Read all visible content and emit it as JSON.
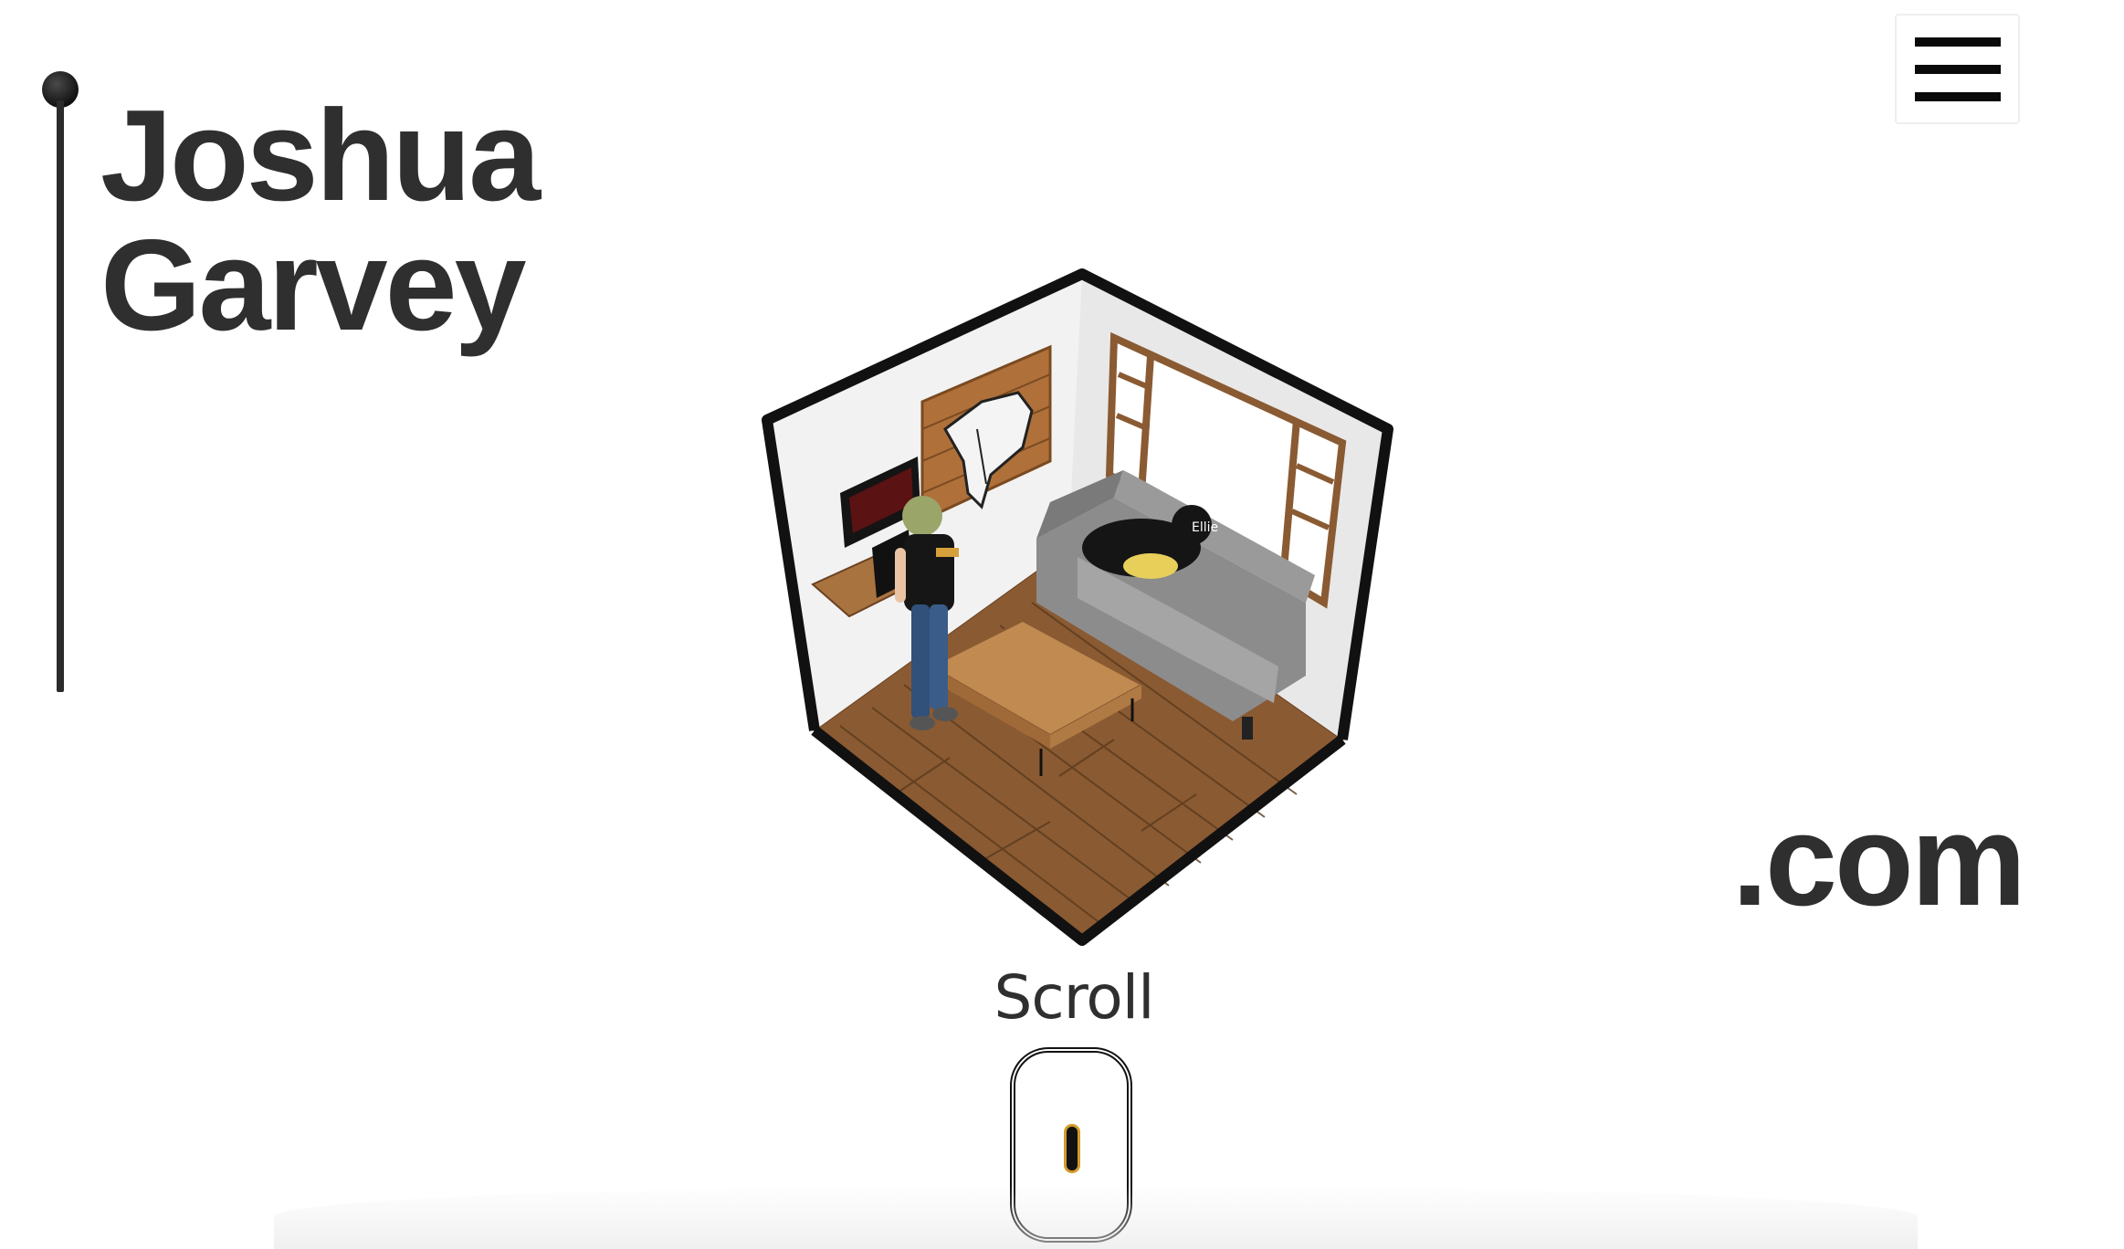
{
  "header": {
    "title_line1": "Joshua",
    "title_line2": "Garvey",
    "tld": ".com"
  },
  "menu": {
    "icon": "hamburger-icon"
  },
  "hero": {
    "illustration": "isometric-room-illustration",
    "dog_name": "Ellie"
  },
  "scroll_hint": {
    "label": "Scroll",
    "icon": "mouse-scroll-icon"
  },
  "colors": {
    "text": "#2f2f2f",
    "accent_wheel": "#d49a2a",
    "floor": "#8a5a32",
    "wall": "#ececec"
  }
}
